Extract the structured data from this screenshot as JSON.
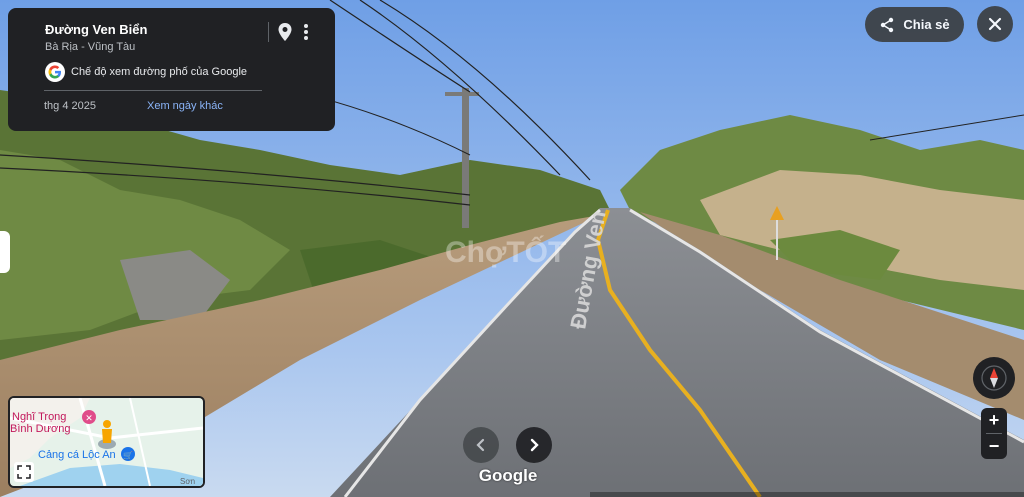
{
  "panel": {
    "title": "Đường Ven Biển",
    "subtitle": "Bà Rịa - Vũng Tàu",
    "mode": "Chế độ xem đường phố của Google",
    "capture_date": "thg 4 2025",
    "other_dates": "Xem ngày khác",
    "icons": [
      "pin-icon",
      "more-vert-icon",
      "google-g-icon"
    ]
  },
  "toolbar": {
    "share_label": "Chia sẻ",
    "share_icon": "share-icon",
    "close_icon": "close-icon"
  },
  "scene": {
    "road_text": "Đường Ven",
    "watermark": "ChợTỐT"
  },
  "minimap": {
    "poi_1": "Nghĩ Trọng",
    "poi_1b": "Bình Dương",
    "poi_2": "Cảng cá Lộc An",
    "edge_label": "Sơn",
    "icons": [
      "hotel-icon",
      "shop-icon",
      "pegman-icon",
      "fullscreen-icon"
    ]
  },
  "controls": {
    "zoom_in": "+",
    "zoom_out": "−",
    "compass_icon": "compass-icon",
    "prev_icon": "chevron-left-icon",
    "next_icon": "chevron-right-icon"
  },
  "branding": {
    "wordmark": "Google"
  },
  "colors": {
    "panel_bg": "#202124",
    "link_blue": "#8ab4f8",
    "road_yellow": "#e8b020",
    "sky_blue": "#8fb4ea"
  }
}
